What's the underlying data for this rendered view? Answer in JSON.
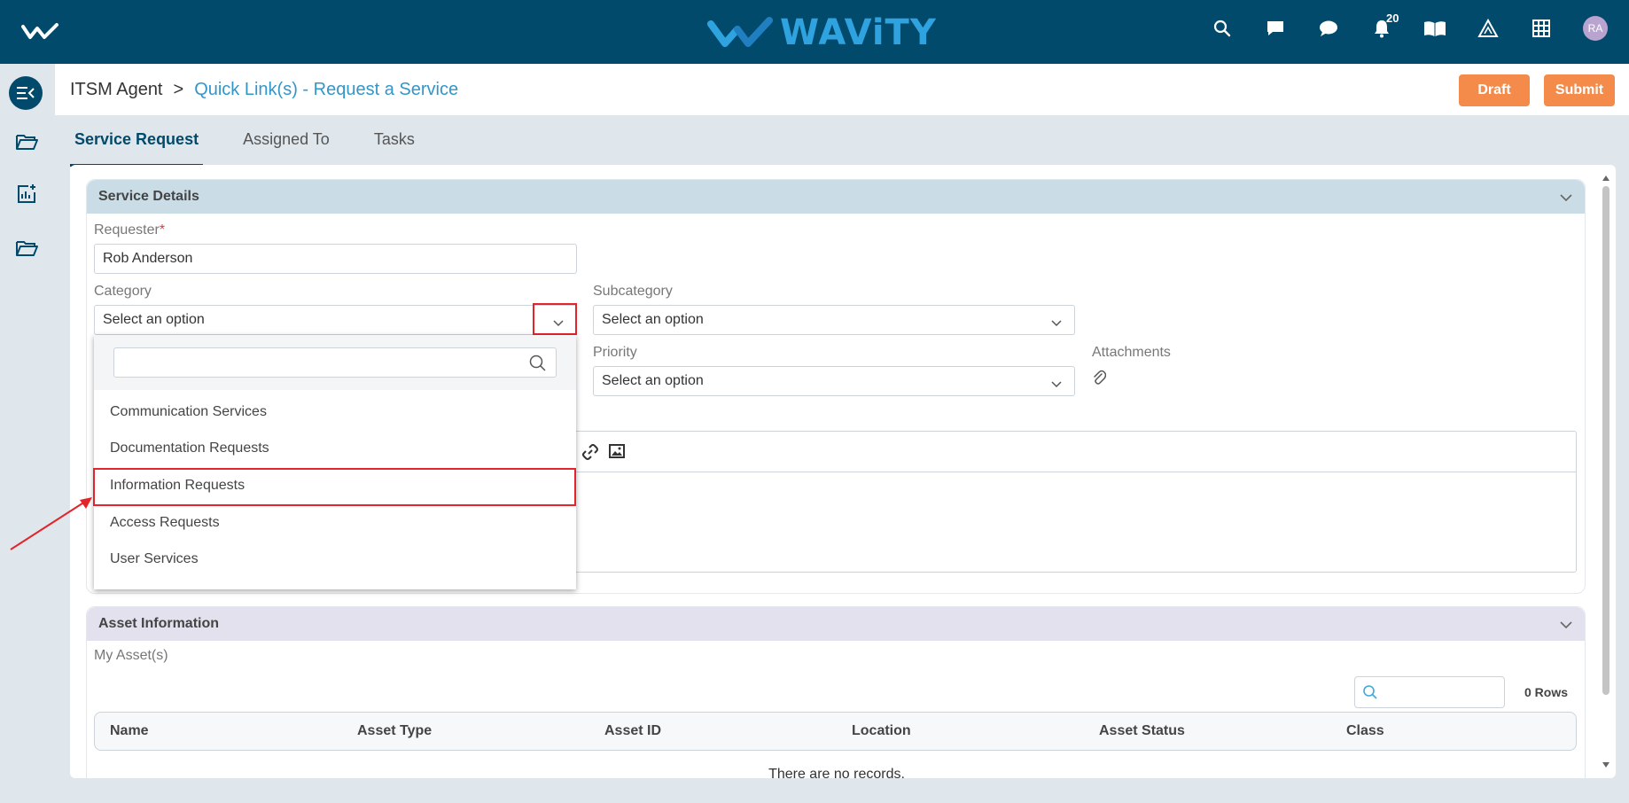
{
  "brand": {
    "name": "WAViTY",
    "logo_color": "#2ea3e0",
    "bar_color": "#024a6b"
  },
  "topbar": {
    "icons": [
      "search-icon",
      "chat-square-icon",
      "chat-bubble-icon",
      "bell-icon",
      "book-icon",
      "warning-icon",
      "grid-icon"
    ],
    "notification_count": "20",
    "avatar_initials": "RA"
  },
  "sidebar": {
    "icons": [
      "menu-collapse-icon",
      "folder-icon",
      "report-add-icon",
      "folder-icon"
    ]
  },
  "breadcrumb": {
    "root": "ITSM Agent",
    "separator": ">",
    "current": "Quick Link(s) - Request a Service"
  },
  "actions": {
    "draft_label": "Draft",
    "submit_label": "Submit",
    "color": "#f58b4a"
  },
  "tabs": [
    {
      "label": "Service Request",
      "active": true
    },
    {
      "label": "Assigned To",
      "active": false
    },
    {
      "label": "Tasks",
      "active": false
    }
  ],
  "service_details": {
    "title": "Service Details",
    "requester_label": "Requester",
    "required_mark": "*",
    "requester_value": "Rob Anderson",
    "category_label": "Category",
    "category_value": "Select an option",
    "subcategory_label": "Subcategory",
    "subcategory_value": "Select an option",
    "priority_label": "Priority",
    "priority_value": "Select an option",
    "attachments_label": "Attachments"
  },
  "category_dropdown": {
    "search_value": "",
    "options": [
      {
        "label": "Communication Services",
        "highlighted": false
      },
      {
        "label": "Documentation Requests",
        "highlighted": false
      },
      {
        "label": "Information Requests",
        "highlighted": true
      },
      {
        "label": "Access Requests",
        "highlighted": false
      },
      {
        "label": "User Services",
        "highlighted": false
      }
    ]
  },
  "asset_information": {
    "title": "Asset Information",
    "my_assets_label": "My Asset(s)",
    "rows_count": "0 Rows",
    "columns": [
      "Name",
      "Asset Type",
      "Asset ID",
      "Location",
      "Asset Status",
      "Class"
    ],
    "empty_text": "There are no records."
  },
  "annotation_color": "#e3242b"
}
